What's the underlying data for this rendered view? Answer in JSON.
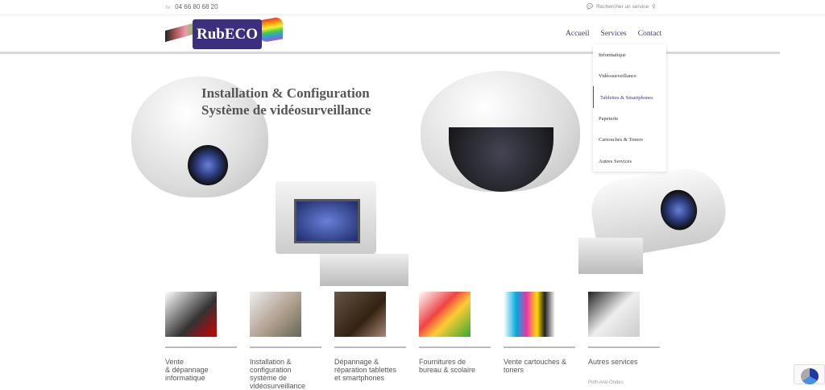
{
  "topbar": {
    "tel_prefix": "Tel :",
    "phone": "04 66 80 68 20",
    "search_placeholder": "Rechercher un service"
  },
  "logo": {
    "text": "RubECO"
  },
  "nav": {
    "items": [
      {
        "label": "Accueil"
      },
      {
        "label": "Services"
      },
      {
        "label": "Contact"
      }
    ]
  },
  "dropdown": {
    "items": [
      {
        "label": "Informatique"
      },
      {
        "label": "Vidéosurveillance"
      },
      {
        "label": "Tablettes & Smartphones"
      },
      {
        "label": "Papeterie"
      },
      {
        "label": "Cartouches & Toners"
      },
      {
        "label": "Autres Services"
      }
    ]
  },
  "hero": {
    "line1": "Installation & Configuration",
    "line2": "Système de vidéosurveillance"
  },
  "cards": [
    {
      "label": "Vente\n& dépannage\ninformatique"
    },
    {
      "label": "Installation &\nconfiguration\nsystème de\nvidéosurveillance"
    },
    {
      "label": "Dépannage &\nréparation tablettes\net smartphones"
    },
    {
      "label": "Fournitures de\nbureau & scolaire"
    },
    {
      "label": "Vente cartouches &\ntoners"
    },
    {
      "label": "Autres services"
    }
  ],
  "footer_partial": "Poth Anti-Ondes"
}
